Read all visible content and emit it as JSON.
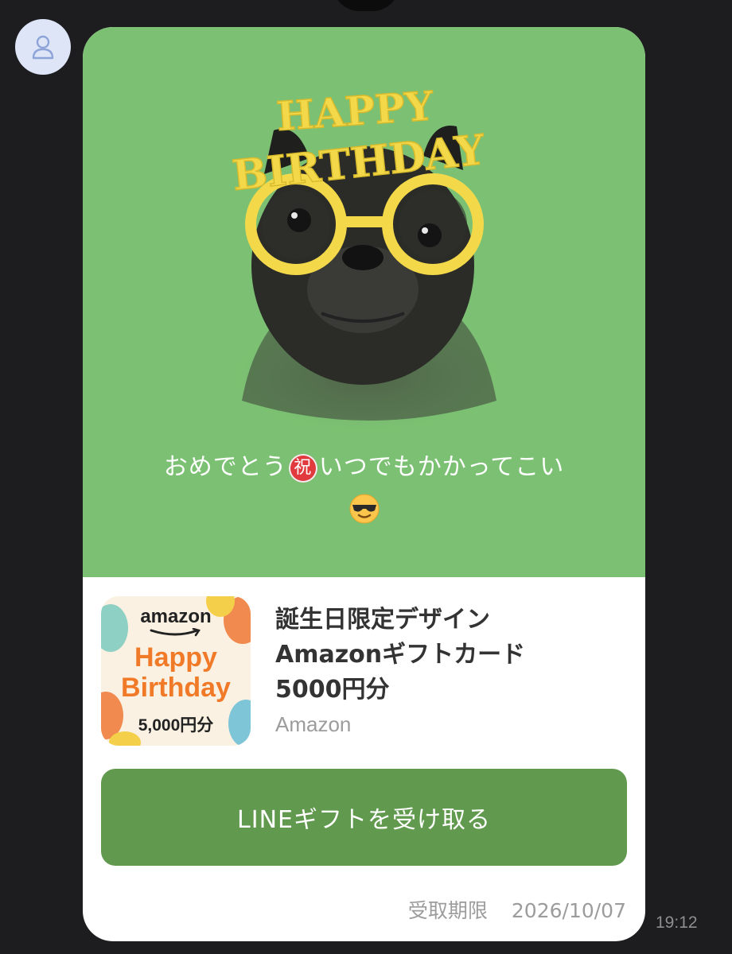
{
  "message_card": {
    "greeting_line1_a": "おめでとう",
    "greeting_iwai": "祝",
    "greeting_line1_b": "いつでもかかってこい",
    "hero_banner_text": "HAPPY BIRTHDAY",
    "product": {
      "thumb_brand": "amazon",
      "thumb_line1": "Happy",
      "thumb_line2": "Birthday",
      "thumb_amount": "5,000円分",
      "title_line1": "誕生日限定デザイン",
      "title_line2": "Amazonギフトカード",
      "title_line3": "5000円分",
      "brand": "Amazon"
    },
    "cta_label": "LINEギフトを受け取る",
    "expiry_label": "受取期限",
    "expiry_date": "2026/10/07"
  },
  "timestamp": "19:12",
  "colors": {
    "background": "#1d1d1f",
    "hero_green": "#7cc173",
    "cta_green": "#619a4f",
    "avatar_bg": "#dde5f7"
  },
  "icons": {
    "avatar": "user-silhouette-icon",
    "emoji": "sunglasses-face-icon",
    "iwai": "celebration-kanji-icon"
  }
}
